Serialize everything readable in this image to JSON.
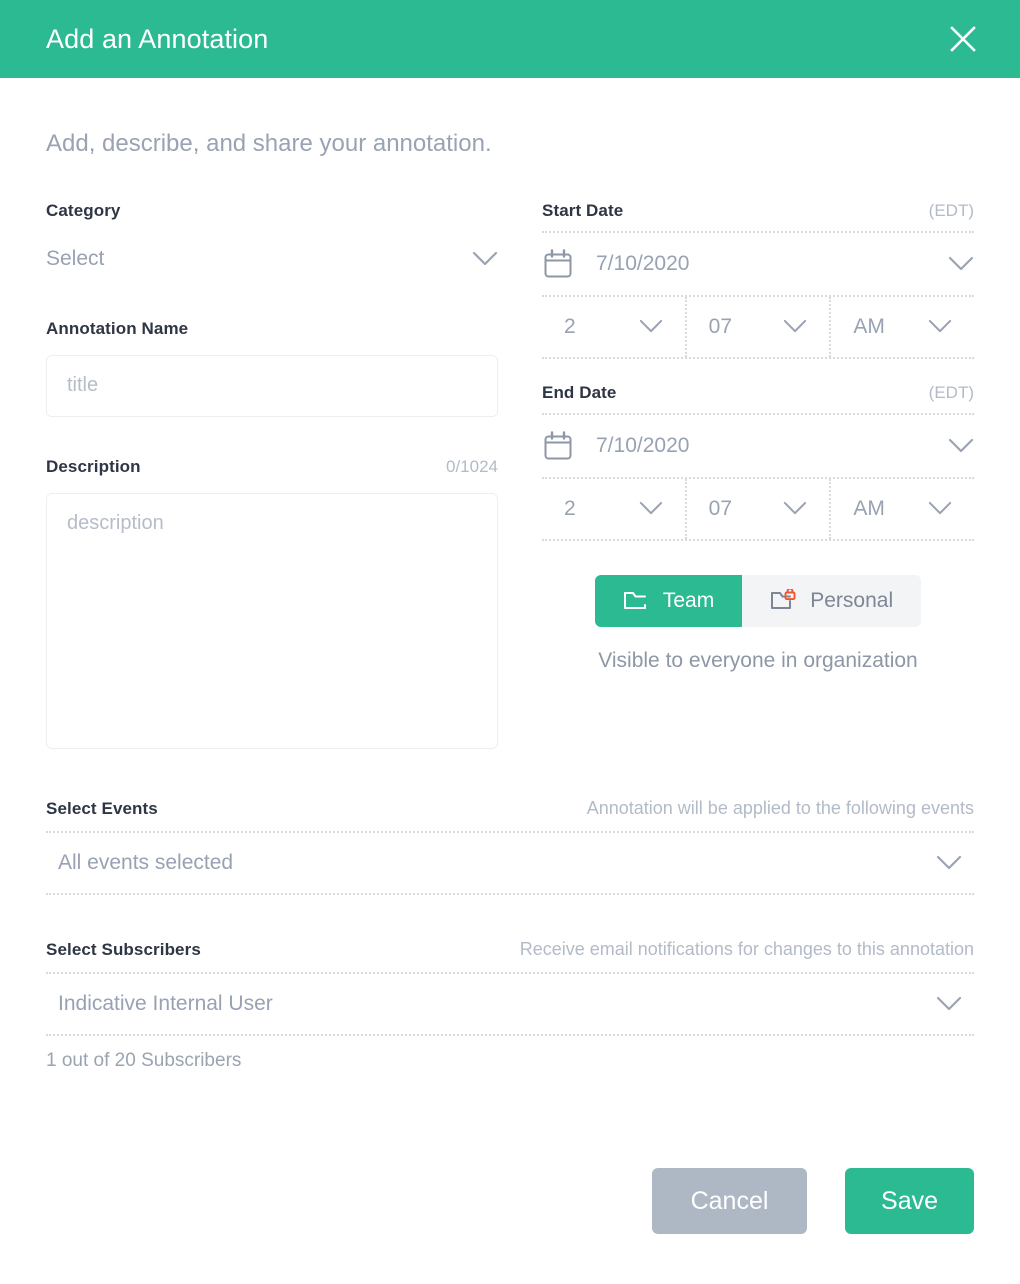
{
  "header": {
    "title": "Add an Annotation",
    "close_icon": "close-icon",
    "bg_color": "#2cba93"
  },
  "subtitle": "Add, describe, and share your annotation.",
  "left": {
    "category": {
      "label": "Category",
      "value": "Select",
      "chevron_icon": "chevron-down-icon"
    },
    "annotation_name": {
      "label": "Annotation Name",
      "value": "",
      "placeholder": "title"
    },
    "description": {
      "label": "Description",
      "counter": "0/1024",
      "value": "",
      "placeholder": "description"
    }
  },
  "right": {
    "start_date": {
      "label": "Start Date",
      "timezone": "(EDT)",
      "calendar_icon": "calendar-icon",
      "date": "7/10/2020",
      "hour": "2",
      "minute": "07",
      "meridiem": "AM"
    },
    "end_date": {
      "label": "End Date",
      "timezone": "(EDT)",
      "calendar_icon": "calendar-icon",
      "date": "7/10/2020",
      "hour": "2",
      "minute": "07",
      "meridiem": "AM"
    },
    "visibility": {
      "team_label": "Team",
      "team_icon": "folder-icon",
      "personal_label": "Personal",
      "personal_icon": "folder-lock-icon",
      "selected": "Team",
      "note": "Visible to everyone in organization",
      "active_color": "#2cba93",
      "lock_color": "#f4552b"
    }
  },
  "events": {
    "label": "Select Events",
    "hint": "Annotation will be applied to the following events",
    "value": "All events selected",
    "chevron_icon": "chevron-down-icon"
  },
  "subscribers": {
    "label": "Select Subscribers",
    "hint": "Receive email notifications for changes to this annotation",
    "value": "Indicative Internal User",
    "chevron_icon": "chevron-down-icon",
    "count": "1 out of 20 Subscribers"
  },
  "footer": {
    "cancel_label": "Cancel",
    "save_label": "Save",
    "cancel_color": "#aeb7c4",
    "save_color": "#2cba93"
  }
}
